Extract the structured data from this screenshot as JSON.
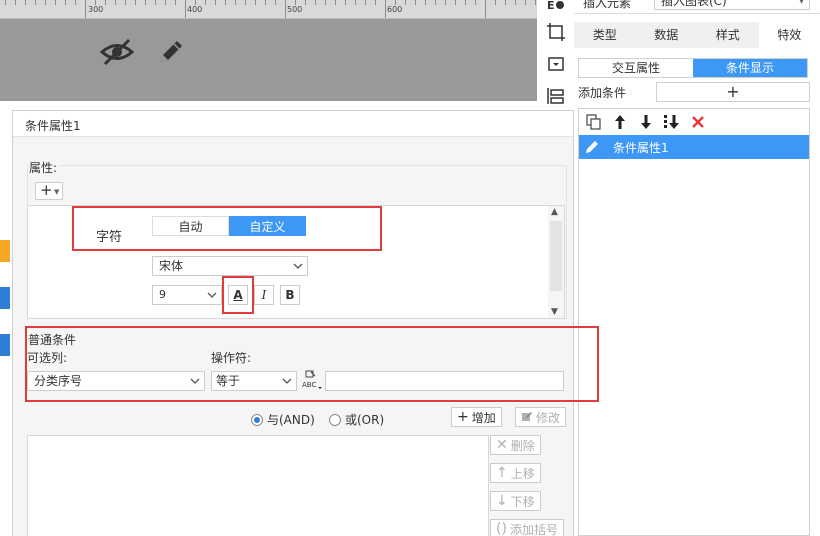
{
  "canvas": {
    "ruler_labels": [
      "300",
      "400",
      "500",
      "600"
    ],
    "icons": [
      "eye-off-icon",
      "pencil-icon"
    ]
  },
  "right_panel": {
    "insert_element": "插入元素",
    "insert_chart": "插入图表(C)",
    "tabs": [
      "类型",
      "数据",
      "样式",
      "特效"
    ],
    "active_tab": "特效",
    "sub_tabs": [
      "交互属性",
      "条件显示"
    ],
    "active_sub_tab": "条件显示",
    "add_condition_label": "添加条件",
    "add_condition_button": "+",
    "condition_items": [
      "条件属性1"
    ]
  },
  "dialog": {
    "title": "条件属性1",
    "attribute_label": "属性:",
    "add_button": "+",
    "char_label": "字符",
    "char_modes": [
      "自动",
      "自定义"
    ],
    "char_mode_active": "自定义",
    "font_name": "宋体",
    "font_size": "9",
    "font_color_button": "A",
    "italic_button": "I",
    "bold_button": "B",
    "common_condition_label": "普通条件",
    "column_label": "可选列:",
    "column_value": "分类序号",
    "operator_label": "操作符:",
    "operator_value": "等于",
    "condition_value": "",
    "radio_and": "与(AND)",
    "radio_or": "或(OR)",
    "radio_selected": "and",
    "add_btn": "增加",
    "modify_btn": "修改",
    "delete_btn": "删除",
    "move_up_btn": "上移",
    "move_down_btn": "下移",
    "add_bracket_btn": "添加括号"
  },
  "colors": {
    "accent": "#3d97f5",
    "highlight_box": "#e23b3b",
    "canvas_bg": "#999999"
  }
}
